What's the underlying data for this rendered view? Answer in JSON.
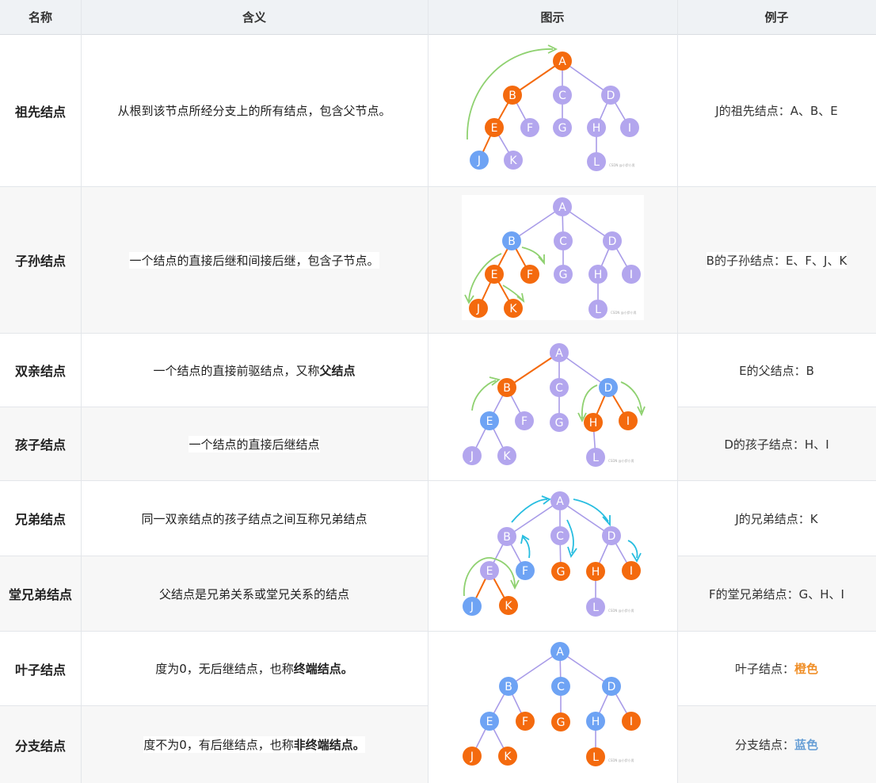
{
  "header": {
    "col_name": "名称",
    "col_meaning": "含义",
    "col_diagram": "图示",
    "col_example": "例子"
  },
  "rows": [
    {
      "name": "祖先结点",
      "meaning": "从根到该节点所经分支上的所有结点，包含父节点。",
      "example": "J的祖先结点：A、B、E"
    },
    {
      "name": "子孙结点",
      "meaning": "一个结点的直接后继和间接后继，包含子节点。",
      "example": "B的子孙结点：E、F、J、K"
    },
    {
      "name": "双亲结点",
      "meaning_pre": "一个结点的直接前驱结点，又称",
      "meaning_bold": "父结点",
      "example": "E的父结点：B"
    },
    {
      "name": "孩子结点",
      "meaning": "一个结点的直接后继结点",
      "example": "D的孩子结点：H、I"
    },
    {
      "name": "兄弟结点",
      "meaning": "同一双亲结点的孩子结点之间互称兄弟结点",
      "example": "J的兄弟结点：K"
    },
    {
      "name": "堂兄弟结点",
      "meaning": "父结点是兄弟关系或堂兄关系的结点",
      "example": "F的堂兄弟结点：G、H、I"
    },
    {
      "name": "叶子结点",
      "meaning_pre": "度为0，无后继结点，也称",
      "meaning_bold": "终端结点。",
      "example_pre": "叶子结点：",
      "example_color": "橙色"
    },
    {
      "name": "分支结点",
      "meaning_pre": "度不为0，有后继结点，也称",
      "meaning_bold": "非终端结点。",
      "example_pre": "分支结点：",
      "example_color": "蓝色"
    }
  ],
  "tree_labels": [
    "A",
    "B",
    "C",
    "D",
    "E",
    "F",
    "G",
    "H",
    "I",
    "J",
    "K",
    "L"
  ],
  "watermark": "CSDN @小伊小男",
  "colors": {
    "purple": "#b3a6ee",
    "orange": "#f46a0e",
    "blue": "#6ea3f4",
    "green": "#8fd170",
    "cyan": "#27bde0",
    "edge_purple": "#a89be8",
    "edge_orange": "#f46a0e"
  },
  "diagrams": [
    {
      "colors": {
        "A": "orange",
        "B": "orange",
        "C": "purple",
        "D": "purple",
        "E": "orange",
        "F": "purple",
        "G": "purple",
        "H": "purple",
        "I": "purple",
        "J": "blue",
        "K": "purple",
        "L": "purple"
      },
      "orange_edges": [
        "A-B",
        "B-E",
        "E-J"
      ]
    },
    {
      "colors": {
        "A": "purple",
        "B": "blue",
        "C": "purple",
        "D": "purple",
        "E": "orange",
        "F": "orange",
        "G": "purple",
        "H": "purple",
        "I": "purple",
        "J": "orange",
        "K": "orange",
        "L": "purple"
      },
      "orange_edges": [
        "B-E",
        "B-F",
        "E-J",
        "E-K"
      ]
    },
    {
      "colors": {
        "A": "purple",
        "B": "orange",
        "C": "purple",
        "D": "blue",
        "E": "blue",
        "F": "purple",
        "G": "purple",
        "H": "orange",
        "I": "orange",
        "J": "purple",
        "K": "purple",
        "L": "purple"
      },
      "orange_edges": [
        "A-B",
        "D-H",
        "D-I"
      ]
    },
    {
      "colors": {
        "A": "purple",
        "B": "purple",
        "C": "purple",
        "D": "purple",
        "E": "purple",
        "F": "blue",
        "G": "orange",
        "H": "orange",
        "I": "orange",
        "J": "blue",
        "K": "orange",
        "L": "purple"
      },
      "orange_edges": [
        "E-J",
        "E-K"
      ]
    },
    {
      "colors": {
        "A": "blue",
        "B": "blue",
        "C": "blue",
        "D": "blue",
        "E": "blue",
        "F": "orange",
        "G": "orange",
        "H": "blue",
        "I": "orange",
        "J": "orange",
        "K": "orange",
        "L": "orange"
      },
      "orange_edges": []
    }
  ]
}
